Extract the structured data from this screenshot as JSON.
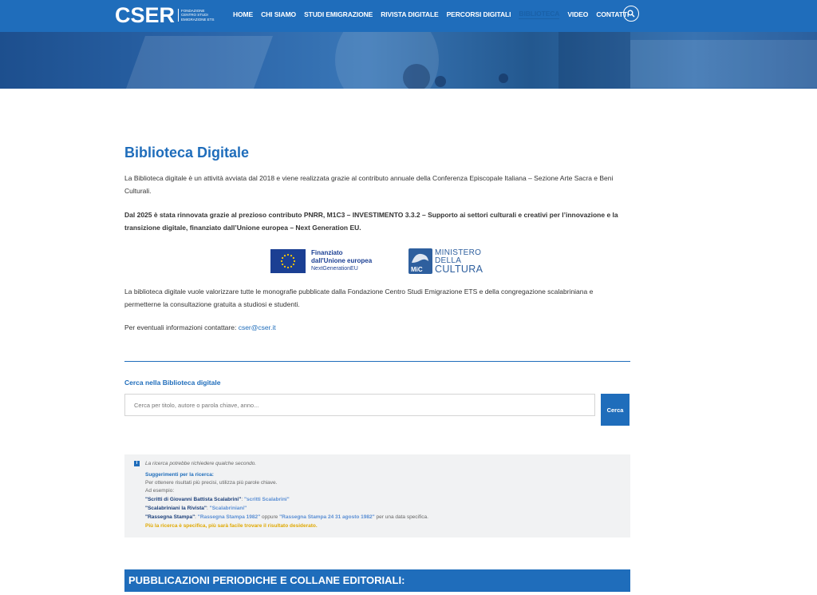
{
  "header": {
    "logo_word": "CSER",
    "logo_sub_1": "Fondazione",
    "logo_sub_2": "Centro Studi",
    "logo_sub_3": "Emigrazione ETS",
    "nav": [
      {
        "label": "HOME"
      },
      {
        "label": "CHI SIAMO"
      },
      {
        "label": "STUDI EMIGRAZIONE"
      },
      {
        "label": "RIVISTA DIGITALE"
      },
      {
        "label": "PERCORSI DIGITALI"
      },
      {
        "label": "BIBLIOTECA"
      },
      {
        "label": "VIDEO"
      },
      {
        "label": "CONTATTI"
      }
    ],
    "active_nav": "BIBLIOTECA",
    "search_icon": "search-icon"
  },
  "main": {
    "title": "Biblioteca Digitale",
    "intro": "La Biblioteca digitale è un attività avviata dal 2018 e  viene realizzata grazie al contributo annuale della Conferenza Episcopale Italiana – Sezione Arte Sacra e Beni Culturali.",
    "funding": "Dal 2025 è stata rinnovata grazie al prezioso contributo PNRR, M1C3 – INVESTIMENTO 3.3.2 – Supporto ai settori culturali e creativi per l’innovazione e la transizione digitale, finanziato dall’Unione europea – Next Generation EU.",
    "eu_logo": {
      "line1": "Finanziato",
      "line2": "dall'Unione europea",
      "line3": "NextGenerationEU"
    },
    "mic_logo": {
      "line1": "MINISTERO",
      "line2": "DELLA",
      "line3": "CULTURA",
      "mark": "MiC"
    },
    "purpose": "La biblioteca digitale vuole valorizzare tutte le monografie pubblicate dalla Fondazione Centro Studi Emigrazione ETS e della congregazione scalabriniana e permetterne la consultazione gratuita a studiosi e studenti.",
    "contact_text": "Per eventuali informazioni contattare: ",
    "contact_email": "cser@cser.it"
  },
  "search": {
    "label": "Cerca nella Biblioteca digitale",
    "placeholder": "Cerca per titolo, autore o parola chiave, anno...",
    "value": "",
    "button": "Cerca"
  },
  "info": {
    "icon": "info-icon",
    "note": "La ricerca potrebbe richiedere qualche secondo.",
    "heading": "Suggerimenti per la ricerca:",
    "tip1": "Per ottenere risultati più precisi, utilizza più parole chiave.",
    "example_label": "Ad esempio:",
    "examples": [
      {
        "label": "\"Scritti di Giovanni Battista Scalabrini\"",
        "sep": ": ",
        "value": "\"scritti Scalabrini\"",
        "mid": "",
        "value2": "",
        "suffix": ""
      },
      {
        "label": "\"Scalabriniani la Rivista\"",
        "sep": ": ",
        "value": "\"Scalabriniani\"",
        "mid": "",
        "value2": "",
        "suffix": ""
      },
      {
        "label": "\"Rassegna Stampa\"",
        "sep": ": ",
        "value": "\"Rassegna Stampa 1982\"",
        "mid": " oppure ",
        "value2": "\"Rassegna Stampa 24 31 agosto 1982\"",
        "suffix": " per una data specifica."
      }
    ],
    "final_tip": "Più la ricerca è specifica, più sarà facile trovare il risultato desiderato."
  },
  "publications": {
    "heading": "PUBBLICAZIONI PERIODICHE E COLLANE EDITORIALI:"
  },
  "colors": {
    "brand_blue": "#1f6dbb",
    "tip_yellow": "#e0a800",
    "info_bg": "#f1f2f3"
  }
}
